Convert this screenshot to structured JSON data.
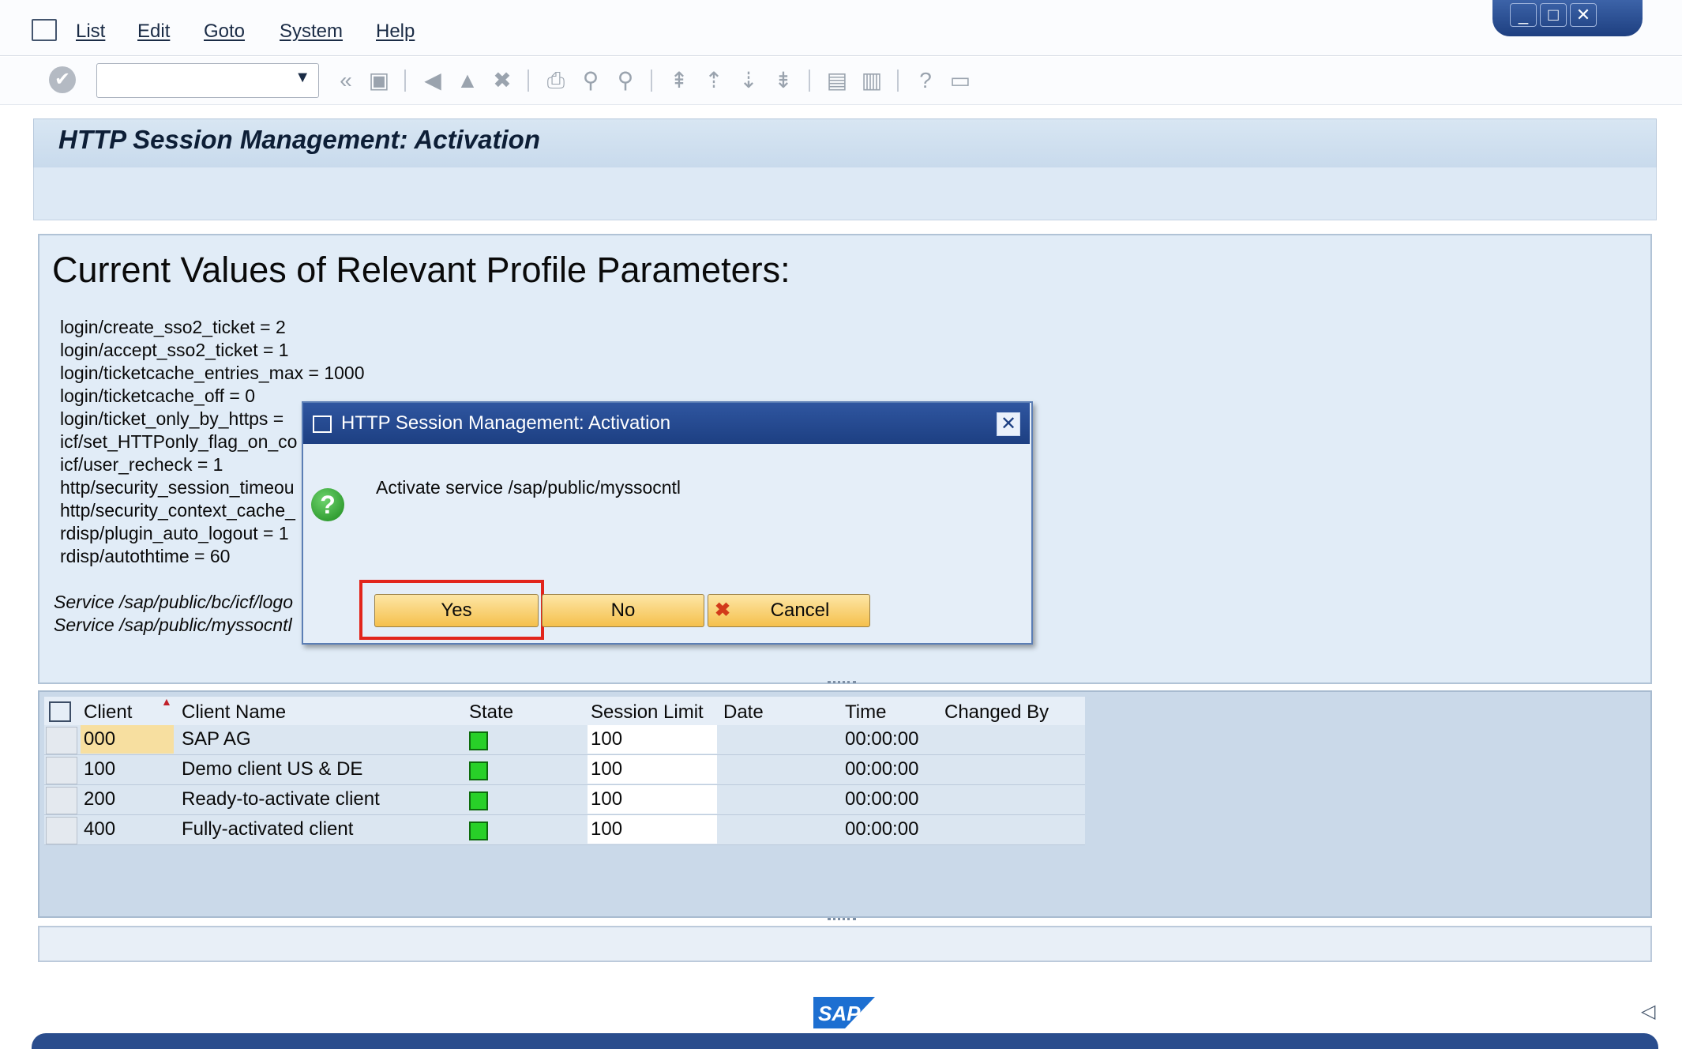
{
  "menubar": {
    "items": [
      "List",
      "Edit",
      "Goto",
      "System",
      "Help"
    ]
  },
  "toolbar": {
    "command_value": ""
  },
  "page": {
    "title": "HTTP Session Management: Activation"
  },
  "params": {
    "heading": "Current Values of Relevant Profile Parameters:",
    "lines": [
      "login/create_sso2_ticket = 2",
      "login/accept_sso2_ticket = 1",
      "login/ticketcache_entries_max = 1000",
      "login/ticketcache_off = 0",
      "login/ticket_only_by_https =",
      "icf/set_HTTPonly_flag_on_co",
      "icf/user_recheck = 1",
      "http/security_session_timeou",
      "http/security_context_cache_",
      "rdisp/plugin_auto_logout = 1",
      "rdisp/autothtime = 60"
    ],
    "services": [
      "Service /sap/public/bc/icf/logo",
      "Service /sap/public/myssocntl"
    ]
  },
  "grid": {
    "headers": [
      "Client",
      "Client Name",
      "State",
      "Session Limit",
      "Date",
      "Time",
      "Changed By"
    ],
    "rows": [
      {
        "client": "000",
        "name": "SAP AG",
        "limit": "100",
        "date": "",
        "time": "00:00:00",
        "changed_by": ""
      },
      {
        "client": "100",
        "name": "Demo client US & DE",
        "limit": "100",
        "date": "",
        "time": "00:00:00",
        "changed_by": ""
      },
      {
        "client": "200",
        "name": "Ready-to-activate client",
        "limit": "100",
        "date": "",
        "time": "00:00:00",
        "changed_by": ""
      },
      {
        "client": "400",
        "name": "Fully-activated client",
        "limit": "100",
        "date": "",
        "time": "00:00:00",
        "changed_by": ""
      }
    ]
  },
  "dialog": {
    "title": "HTTP Session Management: Activation",
    "message": "Activate service /sap/public/myssocntl",
    "yes_label": "Yes",
    "no_label": "No",
    "cancel_label": "Cancel"
  },
  "footer": {
    "logo_text": "SAP"
  },
  "colors": {
    "state_active": "#28d028",
    "button_yellow": "#f5c04c",
    "highlight": "#e2251c",
    "dialog_title_bg": "#1d3f82"
  }
}
